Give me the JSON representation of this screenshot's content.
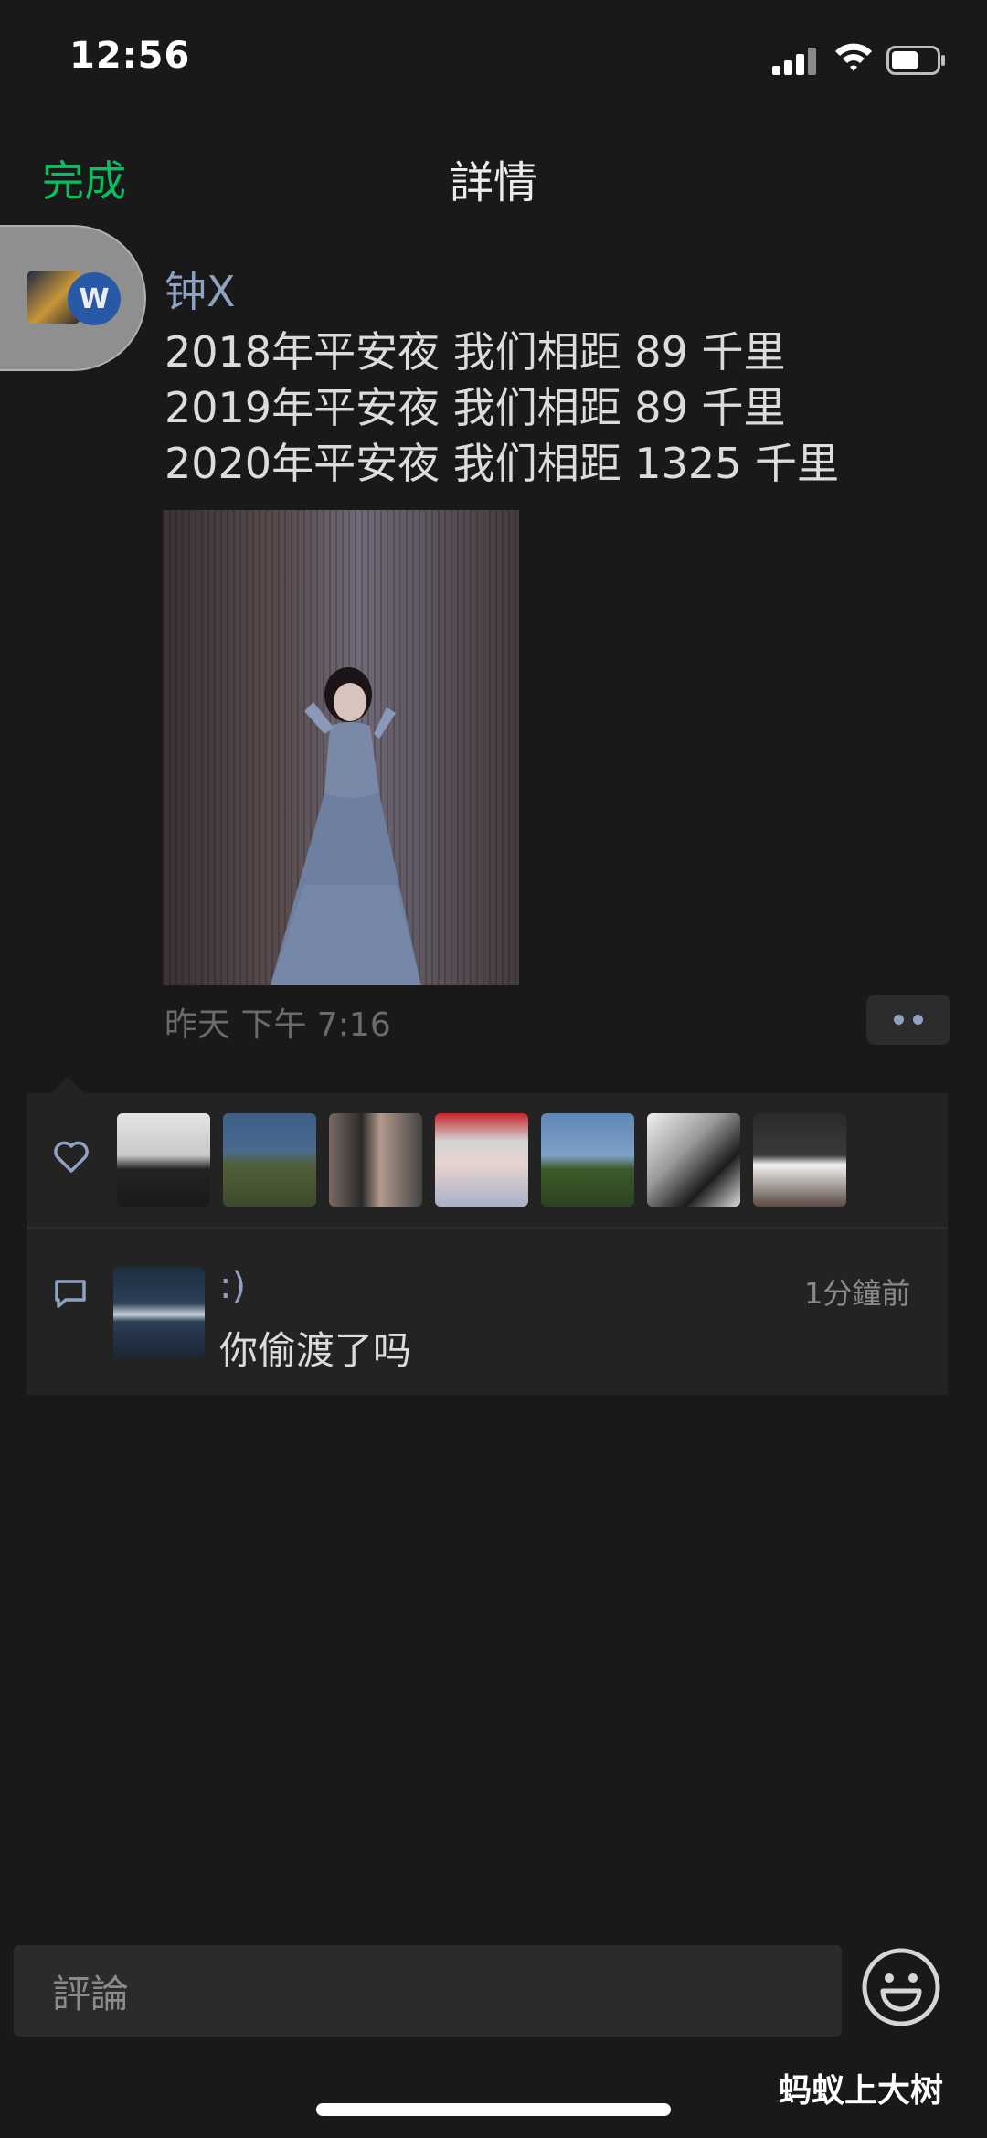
{
  "status_bar": {
    "time": "12:56",
    "battery_level": 0.6
  },
  "nav": {
    "back_label": "完成",
    "title": "詳情"
  },
  "post": {
    "author": "钟X",
    "avatar_badge": "W",
    "lines": [
      "2018年平安夜 我们相距 89 千里",
      "2019年平安夜 我们相距 89 千里",
      "2020年平安夜 我们相距 1325 千里"
    ],
    "time": "昨天 下午 7:16"
  },
  "likes": {
    "count": 7
  },
  "comments": [
    {
      "author": ":)",
      "time": "1分鐘前",
      "text": "你偷渡了吗"
    }
  ],
  "input": {
    "placeholder": "評論"
  },
  "watermark": "蚂蚁上大树",
  "colors": {
    "accent": "#07c160",
    "link": "#8fa2c2",
    "background": "#191919",
    "panel": "#232323"
  }
}
